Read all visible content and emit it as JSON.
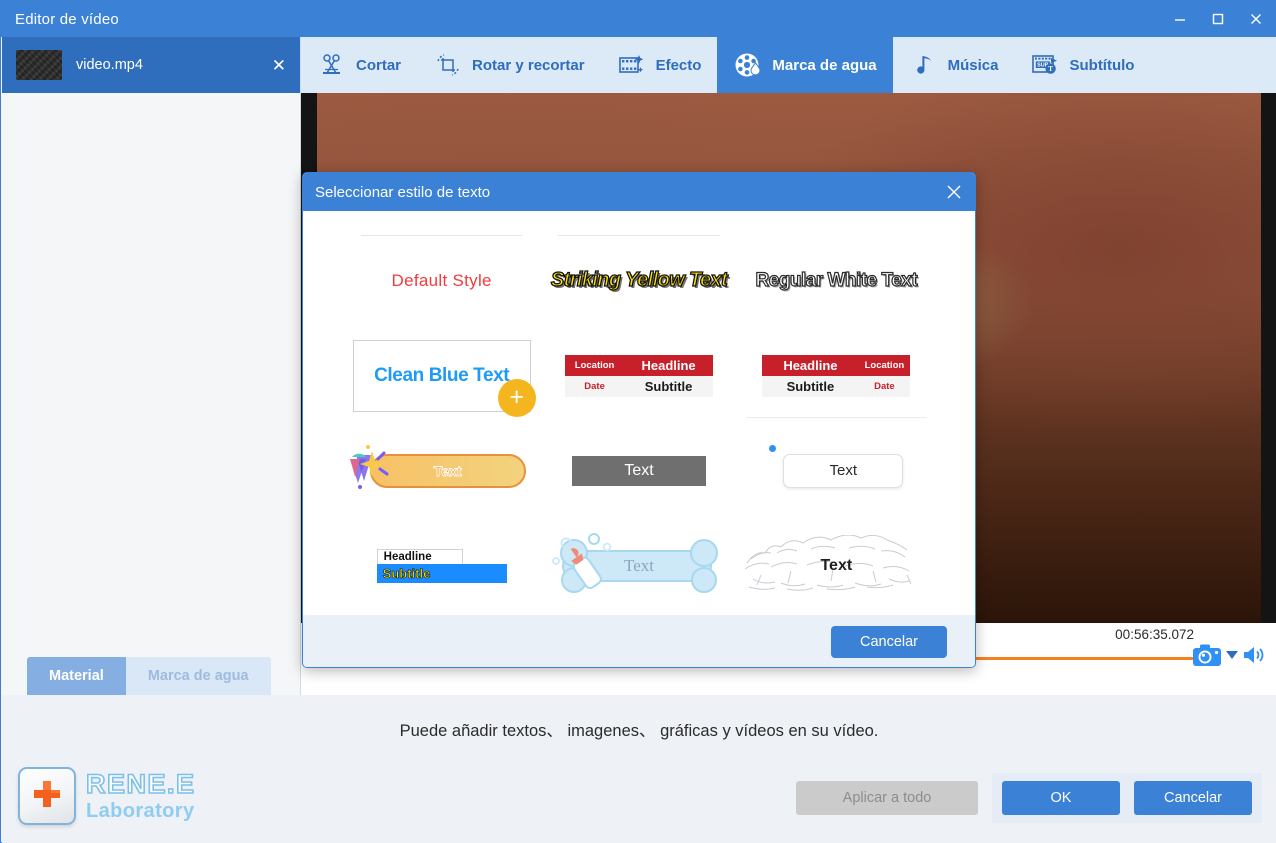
{
  "window": {
    "title": "Editor de vídeo",
    "controls": {
      "minimize": "minimize-icon",
      "maximize": "maximize-icon",
      "close": "close-icon"
    }
  },
  "sidebar": {
    "file": {
      "name": "video.mp4",
      "close_label": "✕",
      "thumbnail": "video-thumbnail"
    },
    "tabs": [
      {
        "label": "Material",
        "active": true
      },
      {
        "label": "Marca de agua",
        "active": false
      }
    ]
  },
  "toolbar": {
    "items": [
      {
        "label": "Cortar",
        "icon": "scissors-icon",
        "active": false
      },
      {
        "label": "Rotar y recortar",
        "icon": "crop-rotate-icon",
        "active": false
      },
      {
        "label": "Efecto",
        "icon": "film-sparkle-icon",
        "active": false
      },
      {
        "label": "Marca de agua",
        "icon": "film-reel-droplet-icon",
        "active": true
      },
      {
        "label": "Música",
        "icon": "music-note-icon",
        "active": false
      },
      {
        "label": "Subtítulo",
        "icon": "subtitle-icon",
        "active": false
      }
    ]
  },
  "preview": {
    "timecode": "00:56:35.072",
    "snapshot_icon": "camera-icon",
    "snapshot_caret": "chevron-down-icon",
    "volume_icon": "speaker-icon"
  },
  "dialog": {
    "title": "Seleccionar estilo de texto",
    "close_label": "✕",
    "cancel_label": "Cancelar",
    "styles": [
      {
        "id": "default-style",
        "kind": "plain-red",
        "text": "Default Style"
      },
      {
        "id": "striking-yellow",
        "kind": "yellow-bold",
        "text": "Striking Yellow Text"
      },
      {
        "id": "regular-white",
        "kind": "white-outline",
        "text": "Regular White Text"
      },
      {
        "id": "clean-blue",
        "kind": "blue-boxed",
        "text": "Clean Blue Text",
        "selected": true,
        "badge": "+"
      },
      {
        "id": "red-banner-left",
        "kind": "table-left",
        "cells": {
          "location": "Location",
          "headline": "Headline",
          "date": "Date",
          "subtitle": "Subtitle"
        }
      },
      {
        "id": "red-banner-right",
        "kind": "table-right",
        "cells": {
          "headline": "Headline",
          "location": "Location",
          "subtitle": "Subtitle",
          "date": "Date"
        }
      },
      {
        "id": "gold-pill",
        "kind": "gold-pill",
        "text": "Text"
      },
      {
        "id": "gray-bar",
        "kind": "gray-bar",
        "text": "Text"
      },
      {
        "id": "white-card",
        "kind": "white-card",
        "text": "Text"
      },
      {
        "id": "headline-subtitle",
        "kind": "headline-subtitle",
        "headline": "Headline",
        "subtitle": "Subtitle"
      },
      {
        "id": "bottle-bubble",
        "kind": "bottle-bubble",
        "text": "Text"
      },
      {
        "id": "sketch-grass",
        "kind": "sketch-grass",
        "text": "Text"
      }
    ]
  },
  "bottom": {
    "hint": "Puede añadir textos、 imagenes、 gráficas y vídeos en su vídeo.",
    "brand": {
      "name": "RENE.E",
      "sub": "Laboratory",
      "icon": "red-cross-key-icon"
    },
    "buttons": {
      "apply_all": "Aplicar a todo",
      "ok": "OK",
      "cancel": "Cancelar"
    }
  },
  "colors": {
    "accent": "#3b82d6",
    "toolbar_bg": "#dce9f7",
    "sidebar_file_bg": "#2f6dbd",
    "timeline_track": "#f58220",
    "badge": "#f5b51f",
    "banner_red": "#c8202a"
  }
}
